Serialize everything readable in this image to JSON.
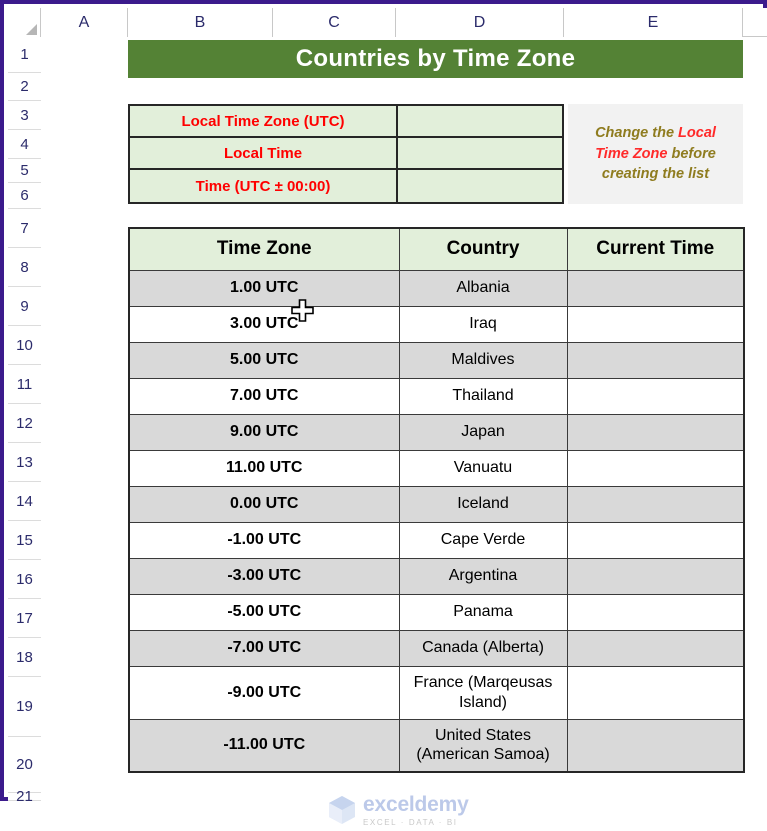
{
  "spreadsheet": {
    "column_headers": [
      "A",
      "B",
      "C",
      "D",
      "E"
    ],
    "row_numbers": [
      "1",
      "2",
      "3",
      "4",
      "5",
      "6",
      "7",
      "8",
      "9",
      "10",
      "11",
      "12",
      "13",
      "14",
      "15",
      "16",
      "17",
      "18",
      "19",
      "20",
      "21"
    ]
  },
  "title": {
    "text": "Countries by Time Zone",
    "bg_color": "#548235",
    "text_color": "#FFFFFF"
  },
  "input_block": {
    "bg_color": "#E2EFDA",
    "label_color": "#FF0000",
    "rows": [
      {
        "label": "Local Time Zone (UTC)",
        "value": ""
      },
      {
        "label": "Local Time",
        "value": ""
      },
      {
        "label": "Time (UTC ± 00:00)",
        "value": ""
      }
    ]
  },
  "note": {
    "part1": "Change the ",
    "highlight1": "Local",
    "part2": " ",
    "highlight2": "Time Zone",
    "part3": " before creating the list",
    "bg_color": "#F2F2F2",
    "text_color": "#8F7C1F",
    "highlight_color": "#FF2A2A"
  },
  "table": {
    "headers": [
      "Time Zone",
      "Country",
      "Current Time"
    ],
    "header_bg": "#E2EFDA",
    "shade_bg": "#D9D9D9",
    "rows": [
      {
        "time_zone": "1.00 UTC",
        "country": "Albania",
        "current_time": "",
        "shaded": true
      },
      {
        "time_zone": "3.00 UTC",
        "country": "Iraq",
        "current_time": "",
        "shaded": false
      },
      {
        "time_zone": "5.00 UTC",
        "country": "Maldives",
        "current_time": "",
        "shaded": true
      },
      {
        "time_zone": "7.00 UTC",
        "country": "Thailand",
        "current_time": "",
        "shaded": false
      },
      {
        "time_zone": "9.00 UTC",
        "country": "Japan",
        "current_time": "",
        "shaded": true
      },
      {
        "time_zone": "11.00 UTC",
        "country": "Vanuatu",
        "current_time": "",
        "shaded": false
      },
      {
        "time_zone": "0.00 UTC",
        "country": "Iceland",
        "current_time": "",
        "shaded": true
      },
      {
        "time_zone": "-1.00 UTC",
        "country": "Cape Verde",
        "current_time": "",
        "shaded": false
      },
      {
        "time_zone": "-3.00 UTC",
        "country": "Argentina",
        "current_time": "",
        "shaded": true
      },
      {
        "time_zone": "-5.00 UTC",
        "country": "Panama",
        "current_time": "",
        "shaded": false
      },
      {
        "time_zone": "-7.00 UTC",
        "country": "Canada (Alberta)",
        "current_time": "",
        "shaded": true
      },
      {
        "time_zone": "-9.00 UTC",
        "country": "France (Marqeusas Island)",
        "current_time": "",
        "shaded": false
      },
      {
        "time_zone": "-11.00 UTC",
        "country": "United States (American Samoa)",
        "current_time": "",
        "shaded": true
      }
    ]
  },
  "watermark": {
    "main": "exceldemy",
    "sub": "EXCEL · DATA · BI"
  }
}
